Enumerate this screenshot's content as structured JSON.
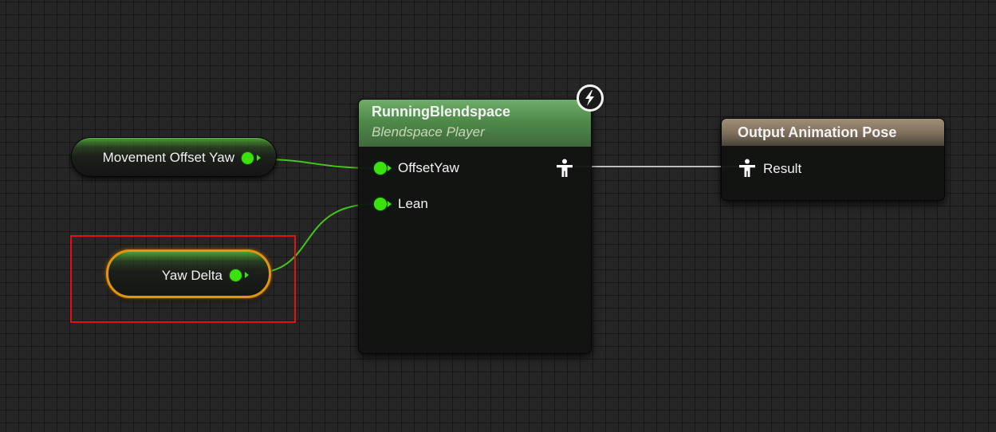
{
  "graph": {
    "variables": [
      {
        "name": "Movement Offset Yaw",
        "selected": false
      },
      {
        "name": "Yaw Delta",
        "selected": true
      }
    ],
    "blendspace_node": {
      "title": "RunningBlendspace",
      "subtitle": "Blendspace Player",
      "inputs": [
        {
          "label": "OffsetYaw",
          "pin_icon": "float-pin-icon"
        },
        {
          "label": "Lean",
          "pin_icon": "float-pin-icon"
        }
      ],
      "output_icon": "pose-icon",
      "badge_icon": "fast-path-lightning-icon"
    },
    "output_node": {
      "title": "Output Animation Pose",
      "inputs": [
        {
          "label": "Result",
          "pin_icon": "pose-icon"
        }
      ]
    },
    "annotation": {
      "type": "highlight-rectangle",
      "target": "Yaw Delta"
    }
  },
  "colors": {
    "canvas_background": "#262626",
    "grid_major": "#141414",
    "float_pin": "#3ae30d",
    "float_wire": "#45c51b",
    "pose_wire": "#bdbdbd",
    "selection_outline": "#e09414",
    "highlight_box": "#e31212",
    "blendspace_header": "#5e9a58",
    "output_header": "#8a7a66"
  }
}
